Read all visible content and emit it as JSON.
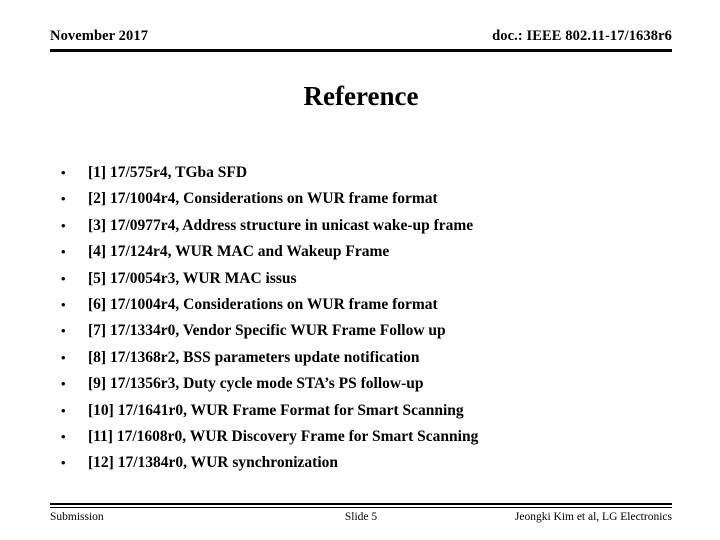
{
  "header": {
    "date": "November 2017",
    "doc": "doc.: IEEE 802.11-17/1638r6"
  },
  "title": "Reference",
  "bullet_glyph": "•",
  "references": [
    {
      "text": "[1] 17/575r4, TGba SFD"
    },
    {
      "text": "[2] 17/1004r4, Considerations on WUR frame format"
    },
    {
      "text": "[3] 17/0977r4, Address structure in unicast wake-up frame"
    },
    {
      "text": "[4] 17/124r4, WUR MAC and Wakeup Frame"
    },
    {
      "text": "[5] 17/0054r3, WUR MAC issus"
    },
    {
      "text": "[6] 17/1004r4, Considerations on WUR frame format"
    },
    {
      "text": "[7] 17/1334r0, Vendor Specific WUR Frame Follow up"
    },
    {
      "text": "[8] 17/1368r2, BSS parameters update notification"
    },
    {
      "text": "[9] 17/1356r3, Duty cycle mode STA’s PS follow-up"
    },
    {
      "text": "[10] 17/1641r0, WUR Frame Format for Smart Scanning"
    },
    {
      "text": "[11] 17/1608r0, WUR Discovery Frame for Smart Scanning"
    },
    {
      "text": "[12] 17/1384r0, WUR synchronization"
    }
  ],
  "footer": {
    "left": "Submission",
    "center": "Slide 5",
    "right": "Jeongki Kim et al, LG Electronics"
  },
  "colors": {
    "text": "#000000",
    "background": "#ffffff",
    "rule": "#000000"
  }
}
